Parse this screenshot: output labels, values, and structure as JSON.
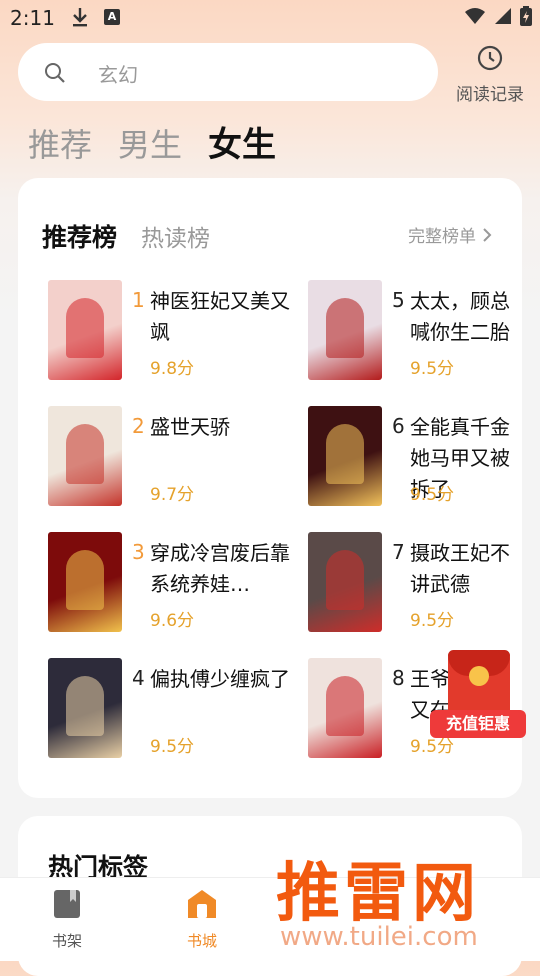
{
  "status_bar": {
    "time": "2:11"
  },
  "search": {
    "placeholder": "玄幻"
  },
  "history": {
    "label": "阅读记录"
  },
  "gender_tabs": [
    {
      "label": "推荐",
      "active": false
    },
    {
      "label": "男生",
      "active": false
    },
    {
      "label": "女生",
      "active": true
    }
  ],
  "rank": {
    "tabs": [
      "推荐榜",
      "热读榜"
    ],
    "more_label": "完整榜单"
  },
  "books": [
    {
      "num": "1",
      "title": "神医狂妃又美又飒",
      "score": "9.8分",
      "cover_bg": "#f3d0cb",
      "cover_accent": "#d3252a"
    },
    {
      "num": "2",
      "title": "盛世天骄",
      "score": "9.7分",
      "cover_bg": "#efe6dc",
      "cover_accent": "#c4332a"
    },
    {
      "num": "3",
      "title": "穿成冷宫废后靠系统养娃…",
      "score": "9.6分",
      "cover_bg": "#7d0b0b",
      "cover_accent": "#f1c24c"
    },
    {
      "num": "4",
      "title": "偏执傅少缠疯了",
      "score": "9.5分",
      "cover_bg": "#2d2b3a",
      "cover_accent": "#e9d0a6"
    },
    {
      "num": "5",
      "title": "太太，顾总喊你生二胎",
      "score": "9.5分",
      "cover_bg": "#e9dde4",
      "cover_accent": "#b31b1b"
    },
    {
      "num": "6",
      "title": "全能真千金她马甲又被拆了",
      "score": "9.5分",
      "cover_bg": "#3e1112",
      "cover_accent": "#f2c25b"
    },
    {
      "num": "7",
      "title": "摄政王妃不讲武德",
      "score": "9.5分",
      "cover_bg": "#5a4a48",
      "cover_accent": "#cf2d2a"
    },
    {
      "num": "8",
      "title": "王爷，王妃又在兴邦！",
      "score": "9.5分",
      "cover_bg": "#efe2dd",
      "cover_accent": "#c91f24"
    }
  ],
  "hot_tags": {
    "heading": "热门标签"
  },
  "bottom_nav": [
    {
      "label": "书架",
      "active": false
    },
    {
      "label": "书城",
      "active": true
    }
  ],
  "promo": {
    "label": "充值钜惠"
  },
  "watermark": {
    "text": "推雷网",
    "url": "www.tuilei.com"
  },
  "colors": {
    "accent": "#f29a3a",
    "score": "#e5a22c",
    "nav_active": "#f08a27"
  }
}
